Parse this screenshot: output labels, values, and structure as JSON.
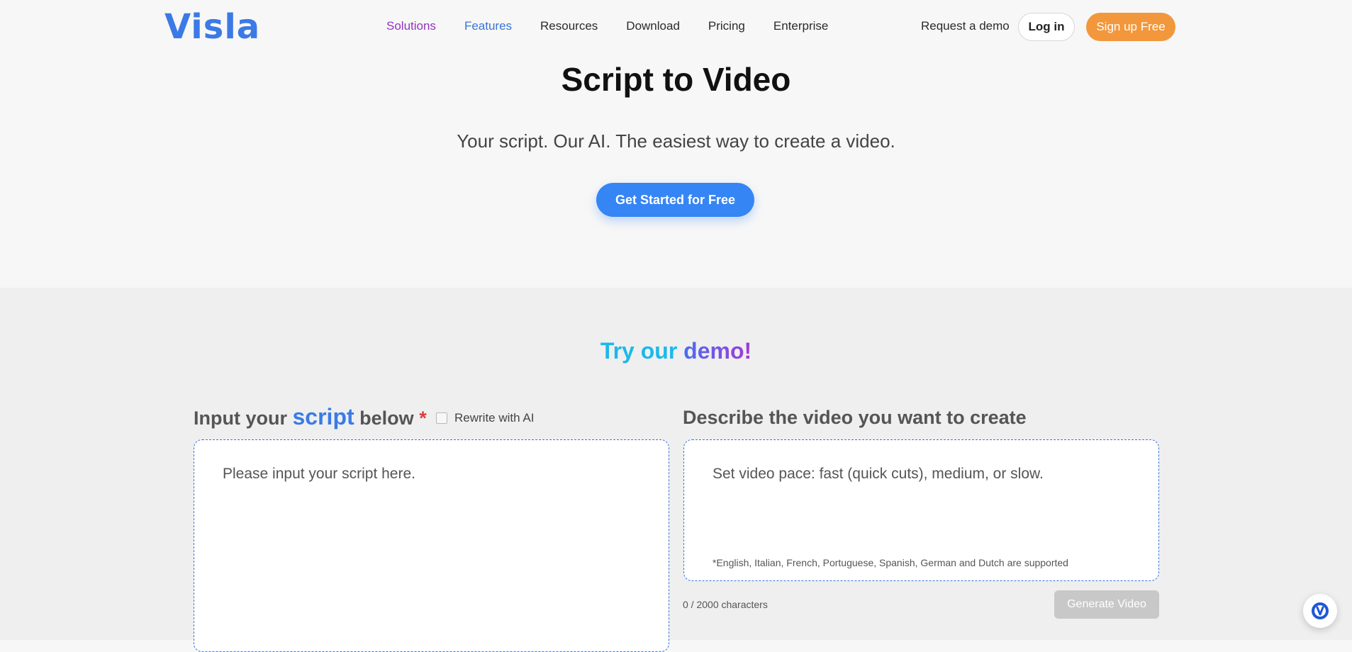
{
  "header": {
    "logo": "Visla",
    "nav": [
      {
        "label": "Solutions"
      },
      {
        "label": "Features"
      },
      {
        "label": "Resources"
      },
      {
        "label": "Download"
      },
      {
        "label": "Pricing"
      },
      {
        "label": "Enterprise"
      }
    ],
    "request_demo": "Request a demo",
    "login": "Log in",
    "signup": "Sign up Free"
  },
  "hero": {
    "title": "Script to Video",
    "subtitle": "Your script. Our AI. The easiest way to create a video.",
    "cta": "Get Started for Free"
  },
  "demo": {
    "title_part1": "Try our",
    "title_part2": "demo!",
    "left_label": {
      "prefix": "Input your",
      "highlight": "script",
      "suffix": "below",
      "required": "*"
    },
    "rewrite_label": "Rewrite with AI",
    "rewrite_checked": false,
    "right_label": "Describe the video you want to create",
    "script_placeholder": "Please input your script here.",
    "describe_placeholder": "Set video pace: fast (quick cuts), medium, or slow.",
    "language_note": "*English, Italian, French, Portuguese, Spanish, German and Dutch are supported",
    "char_count": "0 / 2000 characters",
    "generate": "Generate Video"
  },
  "chat_widget": {
    "icon": "chat-assistant-icon"
  },
  "colors": {
    "brand_blue": "#3b7ae6",
    "cta_blue": "#3585f5",
    "signup_orange": "#f2973c",
    "nav_active_purple": "#9334c0",
    "nav_active_blue": "#3a74d6",
    "required_red": "#e03b3b",
    "demo_cyan": "#1cb8ea"
  }
}
